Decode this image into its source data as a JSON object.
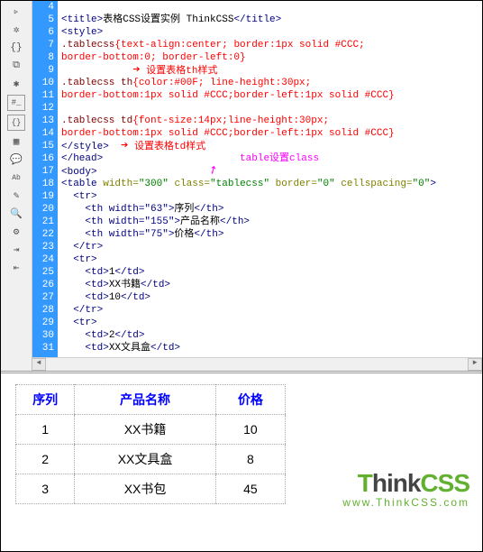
{
  "lineNumbers": [
    "4",
    "5",
    "6",
    "7",
    "8",
    "9",
    "10",
    "11",
    "12",
    "13",
    "14",
    "15",
    "16",
    "17",
    "18",
    "19",
    "20",
    "21",
    "22",
    "23",
    "24",
    "25",
    "26",
    "27",
    "28",
    "29",
    "30",
    "31"
  ],
  "code": {
    "l5_open": "<title>",
    "l5_text": "表格CSS设置实例 ThinkCSS",
    "l5_close": "</title>",
    "l6": "<style>",
    "l7_sel": ".tablecss",
    "l7_body": "{text-align:center; border:1px solid #CCC;",
    "l8": "border-bottom:0; border-left:0}",
    "l9_ann": "设置表格th样式",
    "l10_sel": ".tablecss th",
    "l10_body": "{color:#00F; line-height:30px;",
    "l11": "border-bottom:1px solid #CCC;border-left:1px solid #CCC}",
    "l13_sel": ".tablecss td",
    "l13_body": "{font-size:14px;line-height:30px;",
    "l14": "border-bottom:1px solid #CCC;border-left:1px solid #CCC}",
    "l15": "</style>",
    "l15_ann": "设置表格td样式",
    "l16": "</head>",
    "l17": "<body>",
    "l17_ann": "table设置class",
    "l18a": "<table ",
    "l18_attr1": "width=",
    "l18_v1": "\"300\"",
    "l18_attr2": " class=",
    "l18_v2": "\"tablecss\"",
    "l18_attr3": " border=",
    "l18_v3": "\"0\"",
    "l18_attr4": " cellspacing=",
    "l18_v4": "\"0\"",
    "l18_close": ">",
    "l19": "  <tr>",
    "l20": "    <th width=\"63\">",
    "l20t": "序列",
    "l20c": "</th>",
    "l21": "    <th width=\"155\">",
    "l21t": "产品名称",
    "l21c": "</th>",
    "l22": "    <th width=\"75\">",
    "l22t": "价格",
    "l22c": "</th>",
    "l23": "  </tr>",
    "l24": "  <tr>",
    "l25": "    <td>",
    "l25t": "1",
    "l25c": "</td>",
    "l26": "    <td>",
    "l26t": "XX书籍",
    "l26c": "</td>",
    "l27": "    <td>",
    "l27t": "10",
    "l27c": "</td>",
    "l28": "  </tr>",
    "l29": "  <tr>",
    "l30": "    <td>",
    "l30t": "2",
    "l30c": "</td>",
    "l31": "    <td>",
    "l31t": "XX文具盒",
    "l31c": "</td>"
  },
  "table": {
    "headers": [
      "序列",
      "产品名称",
      "价格"
    ],
    "widths": [
      63,
      155,
      75
    ],
    "rows": [
      [
        "1",
        "XX书籍",
        "10"
      ],
      [
        "2",
        "XX文具盒",
        "8"
      ],
      [
        "3",
        "XX书包",
        "45"
      ]
    ]
  },
  "logo": {
    "t": "T",
    "hink": "hink",
    "css": "CSS",
    "url": "www.ThinkCSS.com"
  }
}
